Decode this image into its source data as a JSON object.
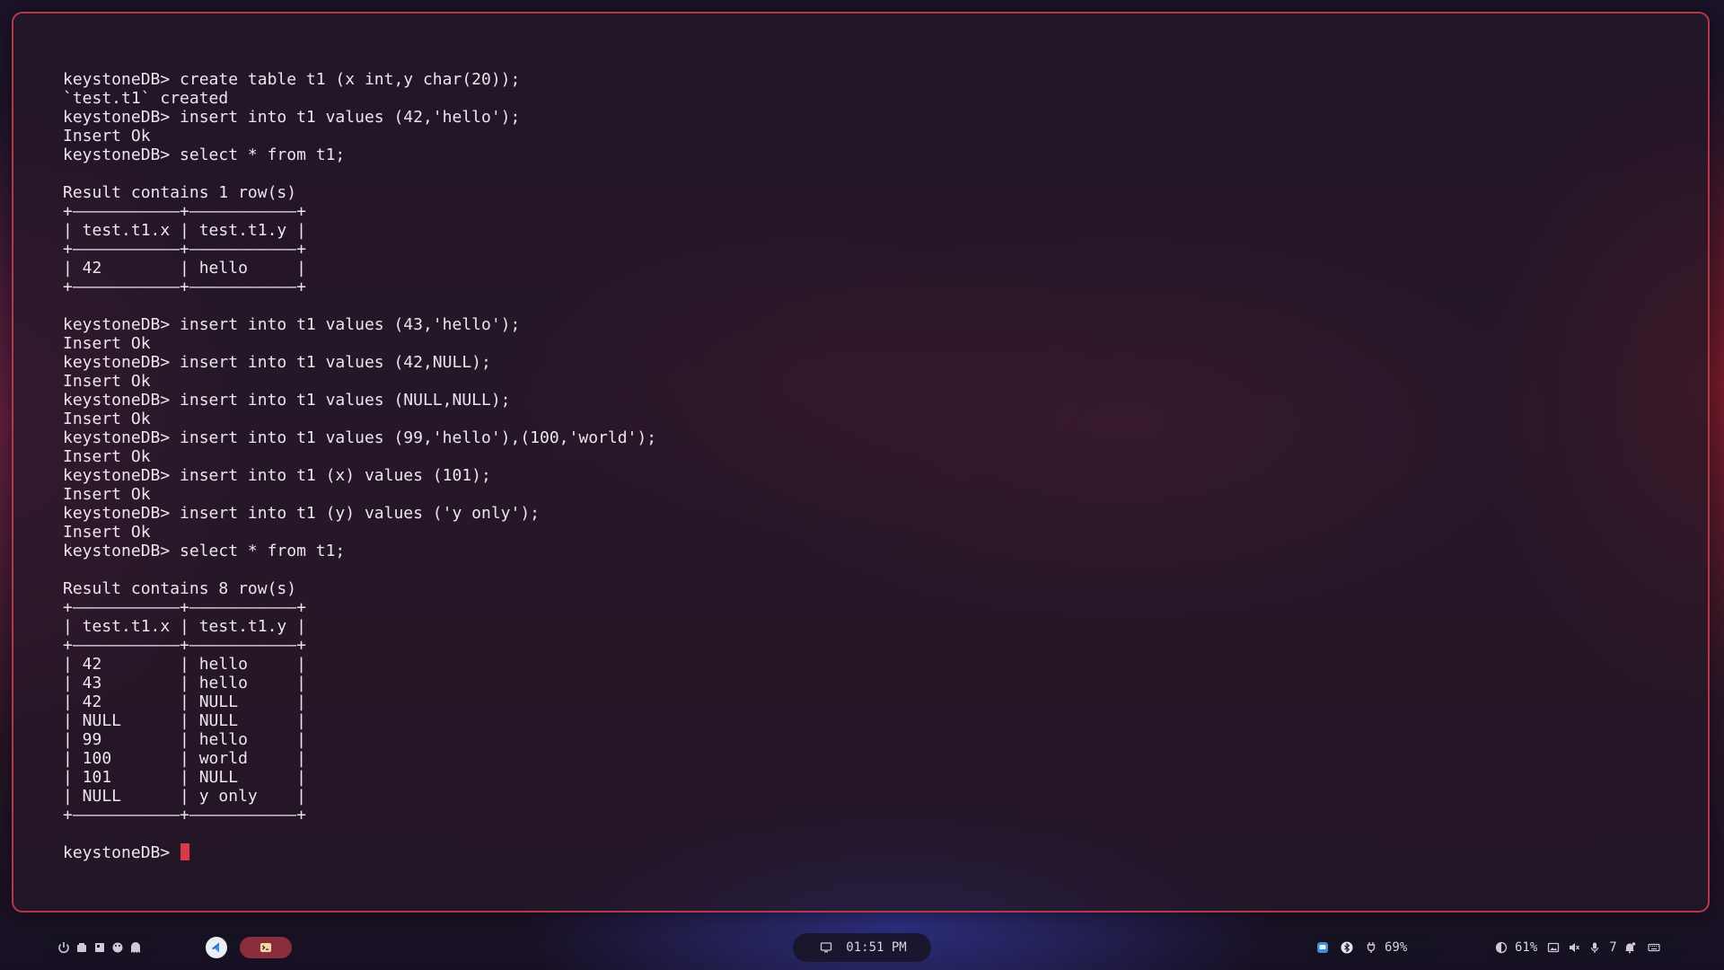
{
  "terminal": {
    "lines": [
      "keystoneDB> create table t1 (x int,y char(20));",
      "`test.t1` created",
      "keystoneDB> insert into t1 values (42,'hello');",
      "Insert Ok",
      "keystoneDB> select * from t1;",
      "",
      "Result contains 1 row(s)",
      "+———————————+———————————+",
      "| test.t1.x | test.t1.y |",
      "+———————————+———————————+",
      "| 42        | hello     |",
      "+———————————+———————————+",
      "",
      "keystoneDB> insert into t1 values (43,'hello');",
      "Insert Ok",
      "keystoneDB> insert into t1 values (42,NULL);",
      "Insert Ok",
      "keystoneDB> insert into t1 values (NULL,NULL);",
      "Insert Ok",
      "keystoneDB> insert into t1 values (99,'hello'),(100,'world');",
      "Insert Ok",
      "keystoneDB> insert into t1 (x) values (101);",
      "Insert Ok",
      "keystoneDB> insert into t1 (y) values ('y only');",
      "Insert Ok",
      "keystoneDB> select * from t1;",
      "",
      "Result contains 8 row(s)",
      "+———————————+———————————+",
      "| test.t1.x | test.t1.y |",
      "+———————————+———————————+",
      "| 42        | hello     |",
      "| 43        | hello     |",
      "| 42        | NULL      |",
      "| NULL      | NULL      |",
      "| 99        | hello     |",
      "| 100       | world     |",
      "| 101       | NULL      |",
      "| NULL      | y only    |",
      "+———————————+———————————+",
      ""
    ],
    "prompt": "keystoneDB> ",
    "cursor_color": "#d83a4a",
    "border_color": "#b23a48"
  },
  "taskbar": {
    "left_icons": [
      "power-icon",
      "files-icon",
      "windows-icon",
      "palette-icon",
      "ghost-icon"
    ],
    "apps": [
      {
        "name": "vscode-icon",
        "color": "#3b8fe0"
      },
      {
        "name": "terminal-app-icon",
        "color": "#8a2e3c"
      }
    ],
    "clock": {
      "icon": "monitor-icon",
      "time": "01:51 PM"
    },
    "battery": {
      "percent": "69%"
    },
    "brightness": {
      "percent": "61%"
    },
    "notifications": {
      "count": "7"
    }
  }
}
